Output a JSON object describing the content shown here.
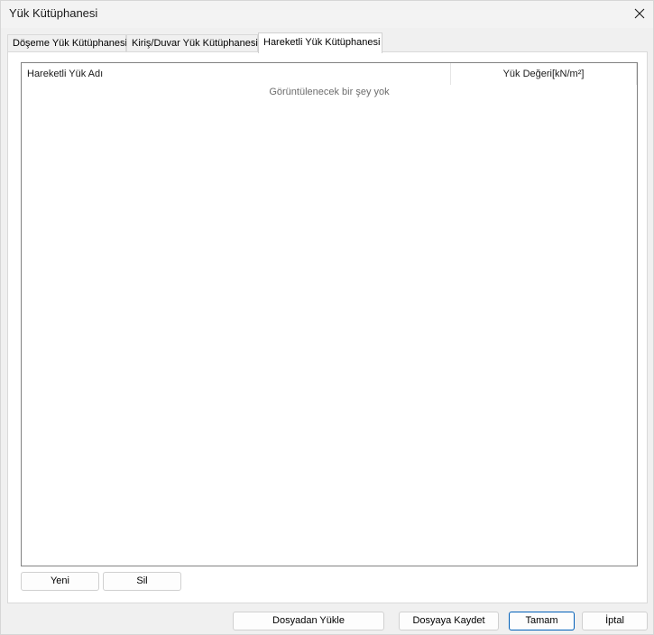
{
  "window": {
    "title": "Yük Kütüphanesi"
  },
  "tabs": [
    {
      "label": "Döşeme Yük Kütüphanesi",
      "active": false
    },
    {
      "label": "Kiriş/Duvar Yük Kütüphanesi",
      "active": false
    },
    {
      "label": "Hareketli Yük Kütüphanesi",
      "active": true
    }
  ],
  "list": {
    "columns": [
      "Hareketli Yük Adı",
      "Yük Değeri[kN/m²]"
    ],
    "rows": [],
    "empty_text": "Görüntülenecek bir şey yok"
  },
  "panel_buttons": {
    "new": "Yeni",
    "delete": "Sil"
  },
  "footer_buttons": {
    "load_from_file": "Dosyadan Yükle",
    "save_to_file": "Dosyaya Kaydet",
    "ok": "Tamam",
    "cancel": "İptal"
  },
  "icons": {
    "close": "close-icon"
  }
}
